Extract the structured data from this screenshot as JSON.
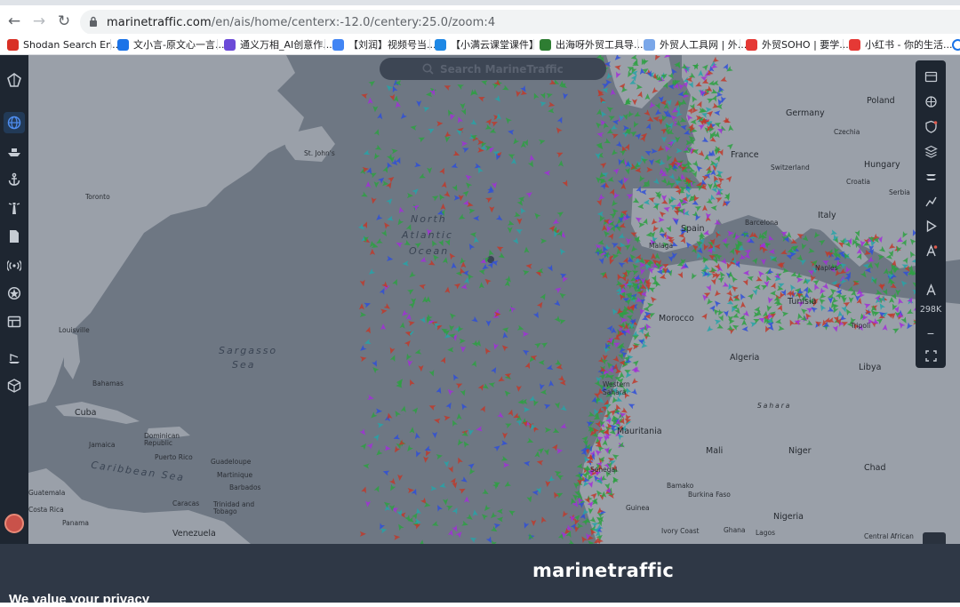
{
  "browser": {
    "url_host": "marinetraffic.com",
    "url_path": "/en/ais/home/centerx:-12.0/centery:25.0/zoom:4",
    "bookmarks": [
      {
        "label": "Shodan Search En...",
        "color": "#d93025",
        "icon": "shodan-icon"
      },
      {
        "label": "文小言-原文心一言...",
        "color": "#1a73e8",
        "icon": "wenxiaoyan-icon"
      },
      {
        "label": "通义万相_AI创意作...",
        "color": "#6c4bd8",
        "icon": "tongyi-icon"
      },
      {
        "label": "【刘润】视频号当...",
        "color": "#4285f4",
        "icon": "liurun-icon"
      },
      {
        "label": "【小满云课堂课件】",
        "color": "#1e88e5",
        "icon": "xiaoman-icon"
      },
      {
        "label": "出海呀外贸工具导...",
        "color": "#2e7d32",
        "icon": "chuhaiya-icon"
      },
      {
        "label": "外贸人工具网 | 外...",
        "color": "#7aa7e9",
        "icon": "waimao-icon"
      },
      {
        "label": "外贸SOHO | 要学...",
        "color": "#e53935",
        "icon": "soho-icon"
      },
      {
        "label": "小红书 - 你的生活...",
        "color": "#e53935",
        "icon": "xiaohongshu-icon"
      }
    ]
  },
  "app": {
    "search_placeholder": "Search MarineTraffic",
    "vessel_count": "298K",
    "brand": "marinetraffic",
    "privacy_heading": "We value your privacy"
  },
  "map_labels": {
    "countries": {
      "germany": "Germany",
      "poland": "Poland",
      "france": "France",
      "czechia": "Czechia",
      "hungary": "Hungary",
      "switzerland": "Switzerland",
      "croatia": "Croatia",
      "serbia": "Serbia",
      "italy": "Italy",
      "spain": "Spain",
      "barcelona": "Barcelona",
      "tunisia": "Tunisia",
      "morocco": "Morocco",
      "algeria": "Algeria",
      "libya": "Libya",
      "western_sahara": "Western Sahara",
      "mauritania": "Mauritania",
      "mali": "Mali",
      "niger": "Niger",
      "chad": "Chad",
      "senegal": "Senegal",
      "guinea": "Guinea",
      "burkina_faso": "Burkina Faso",
      "nigeria": "Nigeria",
      "ivory_coast": "Ivory Coast",
      "ghana": "Ghana",
      "central_african": "Central African",
      "cuba": "Cuba",
      "bahamas": "Bahamas",
      "jamaica": "Jamaica",
      "dominican_republic": "Dominican Republic",
      "puerto_rico": "Puerto Rico",
      "guadeloupe": "Guadeloupe",
      "martinique": "Martinique",
      "barbados": "Barbados",
      "trinidad": "Trinidad and Tobago",
      "caracas": "Caracas",
      "venezuela": "Venezuela",
      "panama": "Panama",
      "costa_rica": "Costa Rica",
      "guatemala": "Guatemala",
      "toronto": "Toronto",
      "st_johns": "St. John's",
      "louisville": "Louisville",
      "lagos": "Lagos",
      "malaga": "Malaga",
      "sahara": "Sahara",
      "bamako": "Bamako",
      "naples": "Naples",
      "tripoli": "Tripoli"
    },
    "oceans": {
      "north_atlantic_1": "North",
      "north_atlantic_2": "Atlantic",
      "north_atlantic_3": "Ocean",
      "sargasso_1": "Sargasso",
      "sargasso_2": "Sea",
      "caribbean": "Caribbean Sea"
    }
  },
  "colors": {
    "map_water": "#6e7783",
    "map_land": "#9aa0a9",
    "sidebar": "#1e2631",
    "consent_bg": "#2f3846",
    "vessel_green": "#2ea043",
    "vessel_red": "#c0392b",
    "vessel_blue": "#2f4fd8",
    "vessel_purple": "#a12fd8",
    "vessel_cyan": "#26a3a8"
  }
}
